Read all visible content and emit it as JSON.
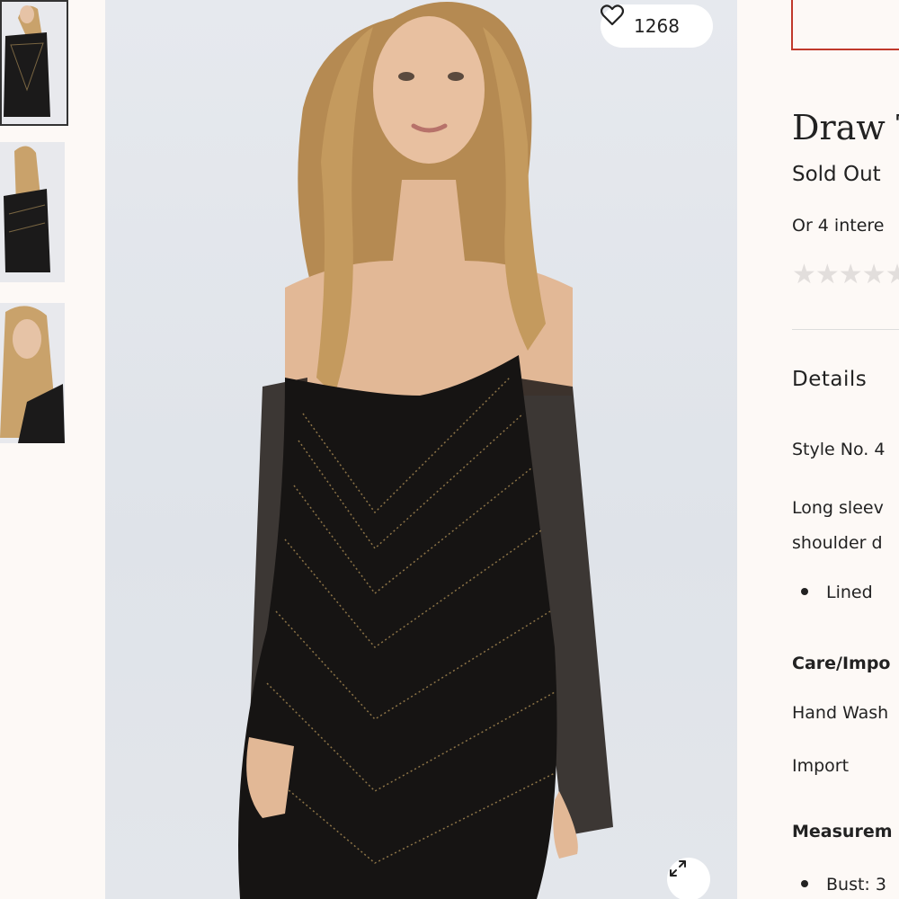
{
  "gallery": {
    "thumbnails": [
      "Front view",
      "Back view",
      "Detail view"
    ],
    "favorite_count": "1268"
  },
  "product": {
    "title": "Draw T",
    "price": "Sold Out",
    "installments": "Or 4 intere",
    "rating_stars": "★★★★★",
    "details_heading": "Details",
    "style_no": "Style No. 4",
    "description_lines": [
      "Long sleev",
      "shoulder d"
    ],
    "features": [
      "Lined"
    ],
    "care_heading": "Care/Impo",
    "care_instructions": "Hand Wash",
    "origin": "Import",
    "measurements_heading": "Measurem",
    "measurements": [
      "Bust: 3"
    ]
  },
  "colors": {
    "accent_red": "#c0392b",
    "background": "#fdf9f6",
    "star_empty": "#e2dedc"
  },
  "icons": [
    "heart-icon",
    "expand-icon"
  ]
}
